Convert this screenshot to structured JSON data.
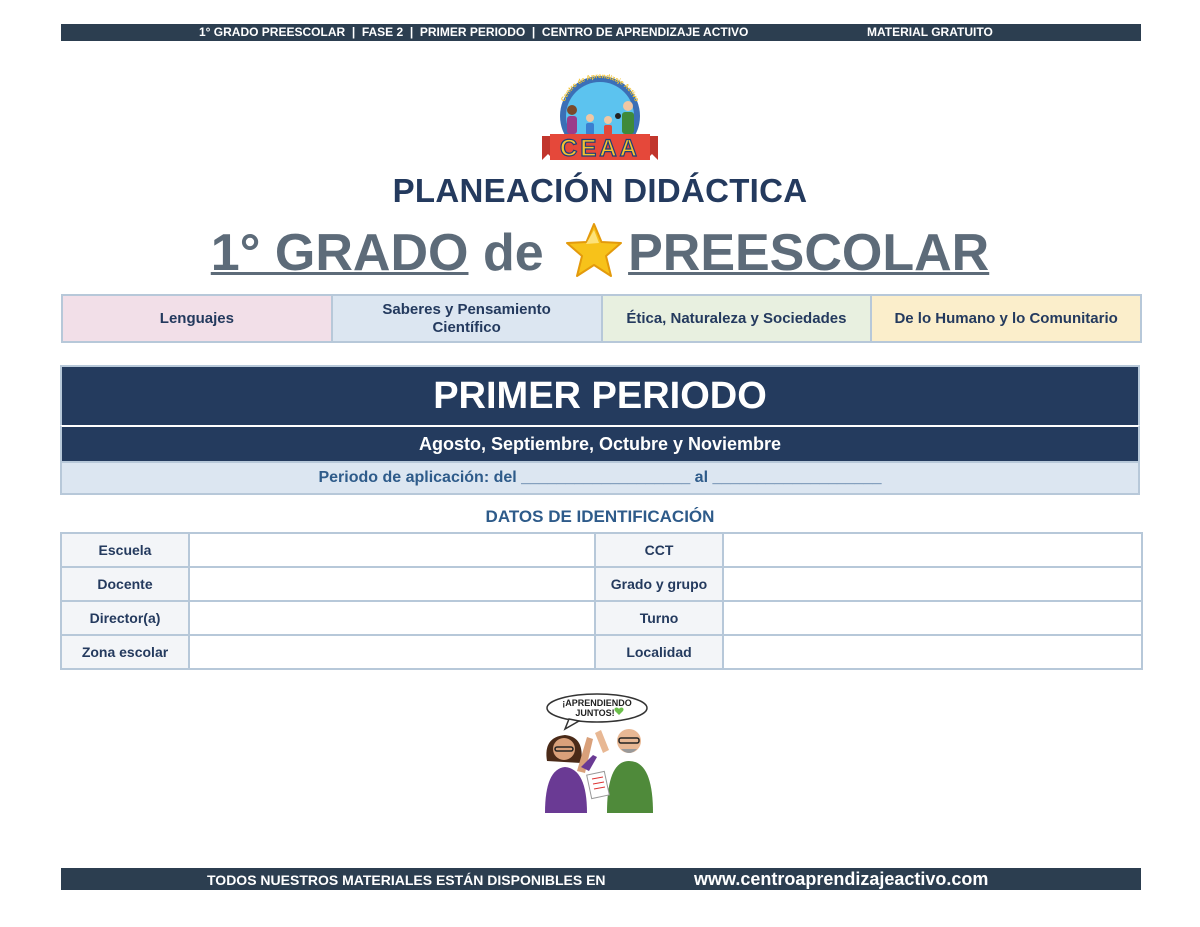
{
  "header": {
    "left_text": "1° GRADO PREESCOLAR  |  FASE 2  |  PRIMER PERIODO  |  CENTRO DE APRENDIZAJE ACTIVO",
    "right_text": "MATERIAL GRATUITO"
  },
  "logo": {
    "text": "CEAA",
    "arc_text": "Centro de Aprendizaje Activo"
  },
  "title": {
    "line1": "PLANEACIÓN DIDÁCTICA",
    "grade": "1° GRADO",
    "connector": "de",
    "level": "PREESCOLAR"
  },
  "fields": [
    {
      "label": "Lenguajes",
      "color": "#f2dfe8"
    },
    {
      "label": "Saberes y Pensamiento Científico",
      "color": "#dce6f1"
    },
    {
      "label": "Ética, Naturaleza y Sociedades",
      "color": "#e8f0e0"
    },
    {
      "label": "De lo Humano y lo Comunitario",
      "color": "#fbeecb"
    }
  ],
  "period": {
    "title": "PRIMER PERIODO",
    "months": "Agosto, Septiembre, Octubre y Noviembre",
    "application": "Periodo de aplicación: del ___________________ al ___________________"
  },
  "identification": {
    "title": "DATOS DE IDENTIFICACIÓN",
    "rows": [
      {
        "left": "Escuela",
        "right": "CCT"
      },
      {
        "left": "Docente",
        "right": "Grado y grupo"
      },
      {
        "left": "Director(a)",
        "right": "Turno"
      },
      {
        "left": "Zona escolar",
        "right": "Localidad"
      }
    ]
  },
  "mascot": {
    "speech": [
      "¡APRENDIENDO",
      "JUNTOS!"
    ]
  },
  "footer": {
    "left_text": "TODOS NUESTROS MATERIALES ESTÁN DISPONIBLES EN",
    "url": "www.centroaprendizajeactivo.com"
  },
  "colors": {
    "dark_bar": "#2c3e50",
    "navy": "#243b5e",
    "title_gray": "#5d6b79",
    "border": "#b7c8d9"
  }
}
